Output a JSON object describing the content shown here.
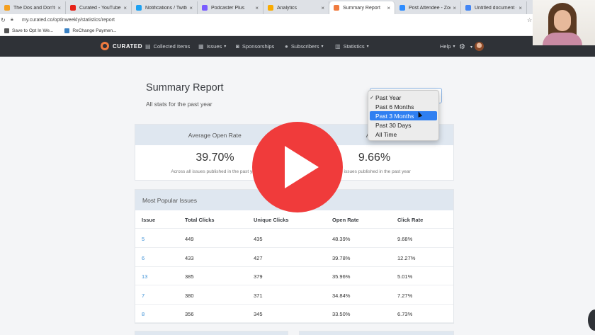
{
  "browser": {
    "tabs": [
      {
        "label": "The Dos and Don'ts of",
        "color": "#f4a020",
        "active": false
      },
      {
        "label": "Curated - YouTube",
        "color": "#e62117",
        "active": false
      },
      {
        "label": "Notifications / Twitter",
        "color": "#1da1f2",
        "active": false
      },
      {
        "label": "Podcaster Plus",
        "color": "#7a5cff",
        "active": false
      },
      {
        "label": "Analytics",
        "color": "#f9ab00",
        "active": false
      },
      {
        "label": "Summary Report",
        "color": "#f07b3f",
        "active": true
      },
      {
        "label": "Post Attendee - Zoom",
        "color": "#2d8cff",
        "active": false
      },
      {
        "label": "Untitled document - G",
        "color": "#4285f4",
        "active": false
      }
    ],
    "url": "my.curated.co/optinweekly/statistics/report",
    "bookmarks": [
      {
        "label": "Save to Opt In We...",
        "color": "#555555"
      },
      {
        "label": "ReChange Paymen...",
        "color": "#3b82c4"
      }
    ]
  },
  "nav": {
    "brand": "CURATED",
    "items": [
      {
        "label": "Collected Items",
        "icon": "document-icon",
        "glyph": "▤"
      },
      {
        "label": "Issues",
        "icon": "book-icon",
        "glyph": "▦"
      },
      {
        "label": "Sponsorships",
        "icon": "camera-icon",
        "glyph": "◙"
      },
      {
        "label": "Subscribers",
        "icon": "user-icon",
        "glyph": "●"
      },
      {
        "label": "Statistics",
        "icon": "bar-chart-icon",
        "glyph": "▥"
      }
    ],
    "help": "Help"
  },
  "page": {
    "title": "Summary Report",
    "subtitle": "All stats for the past year"
  },
  "range_menu": {
    "options": [
      "Past Year",
      "Past 6 Months",
      "Past 3 Months",
      "Past 30 Days",
      "All Time"
    ],
    "checked": "Past Year",
    "highlighted": "Past 3 Months"
  },
  "stats": {
    "open_rate": {
      "label": "Average Open Rate",
      "value": "39.70%",
      "note": "Across all issues published in the past year"
    },
    "click_rate": {
      "label": "Avera",
      "value": "9.66%",
      "note": "all issues published in the past year"
    }
  },
  "popular": {
    "title": "Most Popular Issues",
    "columns": [
      "Issue",
      "Total Clicks",
      "Unique Clicks",
      "Open Rate",
      "Click Rate"
    ],
    "rows": [
      [
        "5",
        "449",
        "435",
        "48.39%",
        "9.68%"
      ],
      [
        "6",
        "433",
        "427",
        "39.78%",
        "12.27%"
      ],
      [
        "13",
        "385",
        "379",
        "35.96%",
        "5.01%"
      ],
      [
        "7",
        "380",
        "371",
        "34.84%",
        "7.27%"
      ],
      [
        "8",
        "356",
        "345",
        "33.50%",
        "6.73%"
      ]
    ]
  },
  "colors": {
    "brand": "#f07b3f",
    "nav_bg": "#2f3237",
    "link": "#3a8fd6",
    "menu_highlight": "#2f7ff1",
    "play_button": "#f03b3b"
  }
}
